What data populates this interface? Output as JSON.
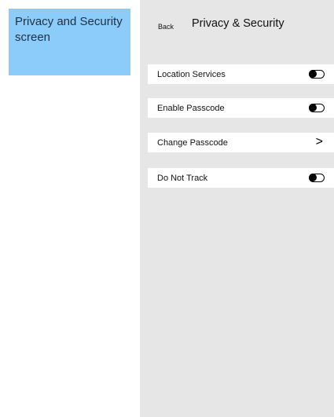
{
  "annotation": {
    "text": "Privacy and Security screen"
  },
  "header": {
    "back_label": "Back",
    "title": "Privacy & Security"
  },
  "settings": {
    "location_services": {
      "label": "Location Services",
      "toggle": "off"
    },
    "enable_passcode": {
      "label": "Enable Passcode",
      "toggle": "off"
    },
    "change_passcode": {
      "label": "Change Passcode",
      "chevron": ">"
    },
    "do_not_track": {
      "label": "Do Not Track",
      "toggle": "off"
    }
  },
  "colors": {
    "annotation_bg": "#8cccfb",
    "screen_bg": "#e6e6e6",
    "row_bg": "#ffffff"
  }
}
